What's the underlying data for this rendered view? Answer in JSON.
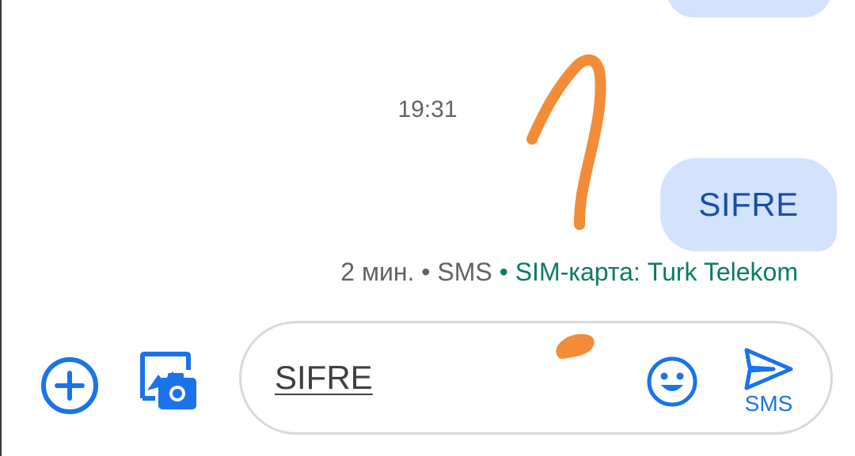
{
  "conversation": {
    "timestamp": "19:31",
    "message": {
      "text": "SIFRE",
      "meta_time": "2 мин.",
      "meta_sep1": " • ",
      "meta_type": "SMS",
      "meta_sep2": " • ",
      "meta_sim": "SIM-карта: Turk Telekom"
    }
  },
  "compose": {
    "input_value": "SIFRE",
    "send_label": "SMS"
  },
  "icons": {
    "add": "add-circle-icon",
    "media": "gallery-camera-icon",
    "emoji": "smiley-icon",
    "send": "send-arrow-icon"
  },
  "colors": {
    "accent": "#1a73e8",
    "bubble": "#d3e3fd",
    "bubble_text": "#174ea6",
    "sim_text": "#0b7a66",
    "annotation": "#f28c38"
  }
}
